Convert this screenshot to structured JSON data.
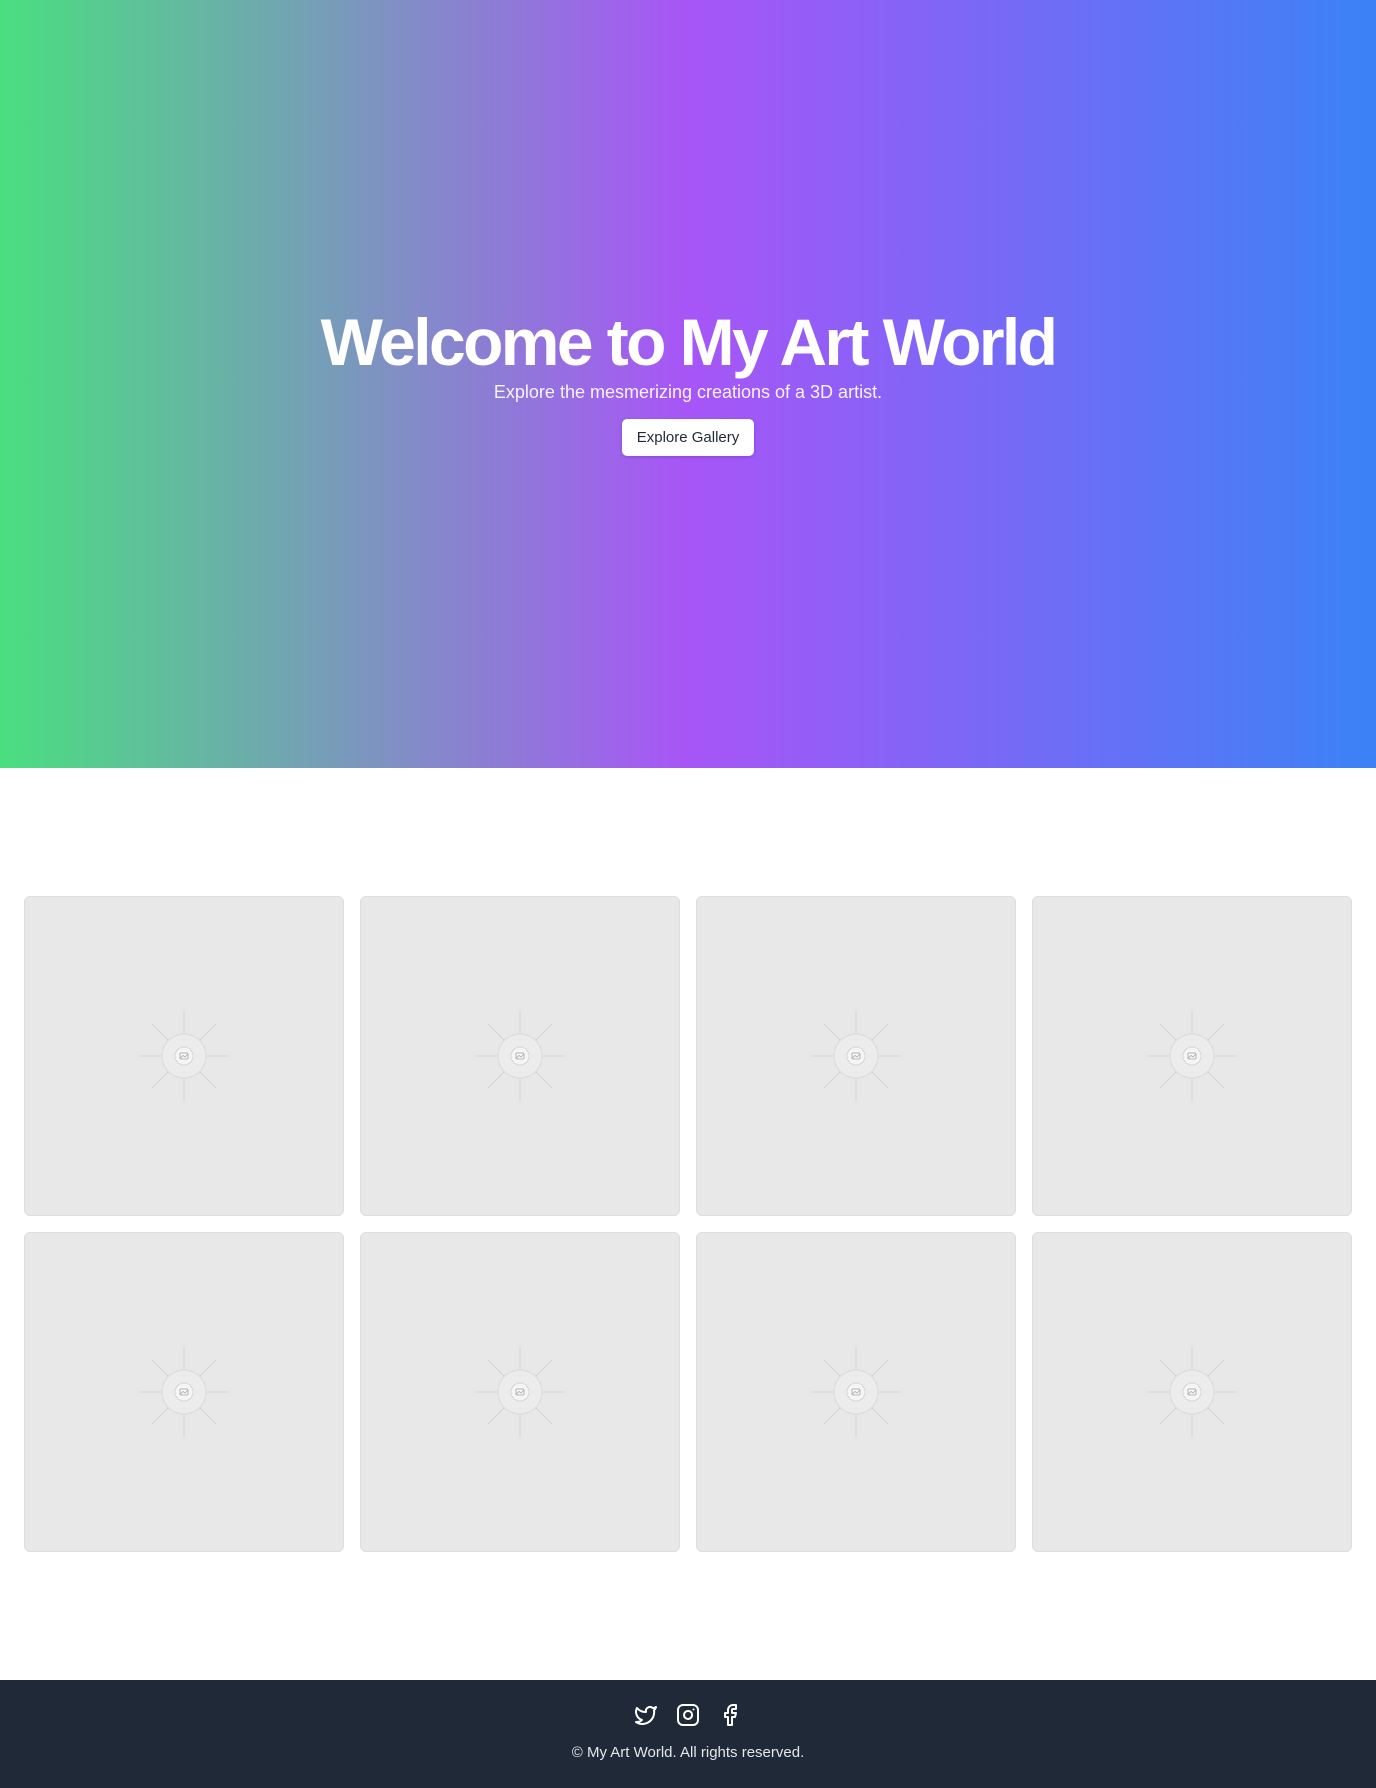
{
  "hero": {
    "title": "Welcome to My Art World",
    "subtitle": "Explore the mesmerizing creations of a 3D artist.",
    "button_label": "Explore Gallery"
  },
  "gallery": {
    "items": [
      {
        "icon": "image-placeholder-icon"
      },
      {
        "icon": "image-placeholder-icon"
      },
      {
        "icon": "image-placeholder-icon"
      },
      {
        "icon": "image-placeholder-icon"
      },
      {
        "icon": "image-placeholder-icon"
      },
      {
        "icon": "image-placeholder-icon"
      },
      {
        "icon": "image-placeholder-icon"
      },
      {
        "icon": "image-placeholder-icon"
      }
    ]
  },
  "footer": {
    "social": [
      {
        "icon": "twitter-icon"
      },
      {
        "icon": "instagram-icon"
      },
      {
        "icon": "facebook-icon"
      }
    ],
    "copyright": "© My Art World. All rights reserved."
  },
  "colors": {
    "gradient_start": "#4ade80",
    "gradient_mid": "#a855f7",
    "gradient_end": "#3b82f6",
    "footer_bg": "#1f2937",
    "card_bg": "#e8e8e8"
  }
}
